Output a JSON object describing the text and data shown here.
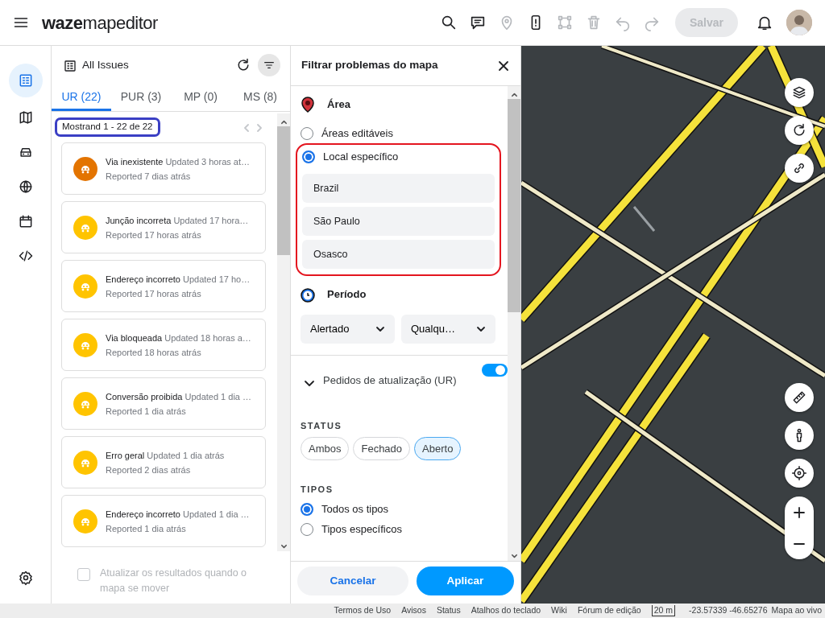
{
  "header": {
    "logo": "**waze**mapeditor",
    "toolbar_icons": [
      {
        "kind": "search",
        "disabled": false
      },
      {
        "kind": "chat",
        "disabled": false
      },
      {
        "kind": "pin",
        "disabled": true
      },
      {
        "kind": "bracket",
        "disabled": false
      },
      {
        "kind": "nodes",
        "disabled": true
      },
      {
        "kind": "trash",
        "disabled": true
      },
      {
        "kind": "undo",
        "disabled": true
      },
      {
        "kind": "redo",
        "disabled": true
      }
    ],
    "save": {
      "label": "Salvar",
      "disabled": true
    }
  },
  "rail": {
    "items": [
      {
        "kind": "issues",
        "selected": true
      },
      {
        "kind": "map",
        "selected": false
      },
      {
        "kind": "car",
        "selected": false
      },
      {
        "kind": "globe",
        "selected": false
      },
      {
        "kind": "calendar",
        "selected": false
      },
      {
        "kind": "code",
        "selected": false
      }
    ]
  },
  "issues_panel": {
    "title": "All Issues",
    "tabs": [
      {
        "label": "UR (22)",
        "selected": true
      },
      {
        "label": "PUR (3)",
        "selected": false
      },
      {
        "label": "MP (0)",
        "selected": false
      },
      {
        "label": "MS (8)",
        "selected": false
      }
    ],
    "pagination": {
      "text": "Mostrand 1 - 22 de 22",
      "highlighted": true
    },
    "issues": [
      {
        "title": "Via inexistente",
        "updated": "Updated 3 horas at…",
        "reported": "Reported 7 dias atrás",
        "color": "#e37400"
      },
      {
        "title": "Junção incorreta",
        "updated": "Updated 17 hora…",
        "reported": "Reported 17 horas atrás",
        "color": "#ffc400"
      },
      {
        "title": "Endereço incorreto",
        "updated": "Updated 17 ho…",
        "reported": "Reported 17 horas atrás",
        "color": "#ffc400"
      },
      {
        "title": "Via bloqueada",
        "updated": "Updated 18 horas a…",
        "reported": "Reported 18 horas atrás",
        "color": "#ffc400"
      },
      {
        "title": "Conversão proibida",
        "updated": "Updated 1 dia …",
        "reported": "Reported 1 dia atrás",
        "color": "#ffc400"
      },
      {
        "title": "Erro geral",
        "updated": "Updated 1 dia atrás",
        "reported": "Reported 2 dias atrás",
        "color": "#ffc400"
      },
      {
        "title": "Endereço incorreto",
        "updated": "Updated 1 dia …",
        "reported": "Reported 1 dia atrás",
        "color": "#ffc400"
      }
    ],
    "auto_update": {
      "label": "Atualizar os resultados quando o mapa se mover",
      "checked": false
    }
  },
  "filter_panel": {
    "title": "Filtrar problemas do mapa",
    "area": {
      "heading": "Área",
      "options": [
        {
          "label": "Áreas editáveis",
          "selected": false
        },
        {
          "label": "Local específico",
          "selected": true
        }
      ],
      "locations": [
        "Brazil",
        "São Paulo",
        "Osasco"
      ],
      "highlighted": true
    },
    "period": {
      "heading": "Período",
      "selects": [
        "Alertado",
        "Qualqu…"
      ]
    },
    "section": {
      "title": "Pedidos de atualização (UR)",
      "expanded": true,
      "on": true
    },
    "status": {
      "heading": "STATUS",
      "chips": [
        {
          "label": "Ambos",
          "selected": false
        },
        {
          "label": "Fechado",
          "selected": false
        },
        {
          "label": "Aberto",
          "selected": true
        }
      ]
    },
    "types": {
      "heading": "TIPOS",
      "options": [
        {
          "label": "Todos os tipos",
          "selected": true
        },
        {
          "label": "Tipos específicos",
          "selected": false
        }
      ]
    },
    "buttons": {
      "cancel": "Cancelar",
      "apply": "Aplicar"
    }
  },
  "map": {
    "controls": [
      {
        "kind": "layers"
      },
      {
        "kind": "refresh"
      },
      {
        "kind": "link"
      },
      {
        "kind": "ruler"
      },
      {
        "kind": "person"
      },
      {
        "kind": "locate"
      }
    ]
  },
  "footer": {
    "links": [
      "Termos de Uso",
      "Avisos",
      "Status",
      "Atalhos do teclado",
      "Wiki",
      "Fórum de edição"
    ],
    "scale": "20 m",
    "coordinates": "-23.57339 -46.65276",
    "live_map": "Mapa ao vivo"
  }
}
